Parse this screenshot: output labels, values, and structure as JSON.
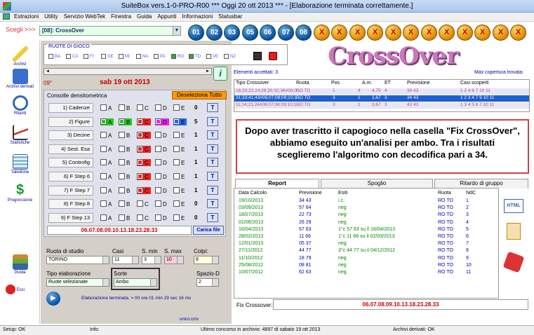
{
  "window": {
    "title": "SuiteBox vers.1-0-PRO-R00  ***  Oggi 20 ott 2013  ***  - [Elaborazione terminata correttamente.]"
  },
  "menu": [
    "Estrazioni",
    "Utility",
    "Servizio WebTek",
    "Finestra",
    "Guida",
    "Appunti",
    "Informazioni",
    "Statusbar"
  ],
  "toolbar": {
    "scegli_label": "Scegli >>>",
    "combo_value": "[08]: CrossOver",
    "numbers": [
      "01",
      "02",
      "03",
      "05",
      "06",
      "07",
      "08"
    ],
    "x_label": "X"
  },
  "sidebar": [
    {
      "label": "Archivi"
    },
    {
      "label": "Archivi derivati"
    },
    {
      "label": "Ritardi"
    },
    {
      "label": "Statistiche"
    },
    {
      "label": "Tabellone"
    },
    {
      "label": "Progressione"
    },
    {
      "label": "Guida"
    },
    {
      "label": "Esci"
    }
  ],
  "ruote": {
    "title": "RUOTE DI GIOCO",
    "items": [
      {
        "label": "BA",
        "on": false
      },
      {
        "label": "CA",
        "on": false
      },
      {
        "label": "FI",
        "on": false
      },
      {
        "label": "GE",
        "on": false
      },
      {
        "label": "MI",
        "on": false
      },
      {
        "label": "NA",
        "on": false
      },
      {
        "label": "PA",
        "on": false
      },
      {
        "label": "RO",
        "on": true
      },
      {
        "label": "TO",
        "on": true
      },
      {
        "label": "VE",
        "on": false
      },
      {
        "label": "NZ",
        "on": false
      }
    ]
  },
  "header": {
    "date_num": "09°",
    "date": "sab 19 ott 2013",
    "info_icon": "i"
  },
  "console": {
    "title": "Consolle densitometrica",
    "deselect": "Deseleziona Tutto",
    "rows": [
      {
        "label": "1) Cadenze",
        "count": "0",
        "checks": [
          0,
          0,
          0,
          0,
          0
        ]
      },
      {
        "label": "2) Figure",
        "count": "5",
        "checks": [
          1,
          1,
          1,
          1,
          1
        ]
      },
      {
        "label": "3) Decine",
        "count": "1",
        "checks": [
          0,
          0,
          1,
          0,
          0
        ]
      },
      {
        "label": "4) Sest. Esa",
        "count": "1",
        "checks": [
          0,
          0,
          1,
          0,
          0
        ]
      },
      {
        "label": "5) Controfig",
        "count": "1",
        "checks": [
          0,
          0,
          1,
          0,
          0
        ]
      },
      {
        "label": "6) F Step 6",
        "count": "1",
        "checks": [
          0,
          0,
          1,
          0,
          0
        ]
      },
      {
        "label": "7) F Step 7",
        "count": "1",
        "checks": [
          0,
          0,
          1,
          0,
          0
        ]
      },
      {
        "label": "8) F Step 8",
        "count": "0",
        "checks": [
          0,
          0,
          0,
          0,
          0
        ]
      },
      {
        "label": "9) F Step 13",
        "count": "0",
        "checks": [
          0,
          0,
          0,
          0,
          0
        ]
      }
    ],
    "letters": [
      "A",
      "B",
      "C",
      "D",
      "E"
    ],
    "t_label": "T",
    "numbers_line": "06.07.08.09.10.13.18.23.28.33",
    "carica": "Carica file"
  },
  "study": {
    "ruota_label": "Ruota di studio",
    "ruota_value": "TORINO",
    "casi_label": "Casi",
    "casi_value": "11",
    "smin_label": "S. min",
    "smin_value": "3",
    "smax_label": "S. max",
    "smax_value": "10",
    "colpi_label": "Colpi:",
    "colpi_value": "8",
    "tipo_label": "Tipo elaborazione",
    "tipo_value": "Ruote selezionate",
    "sorte_label": "Sorte",
    "sorte_value": "Ambo",
    "spazio_label": "Spazio-D",
    "spazio_value": "2",
    "status": "Elaborazione terminata. > 00 ore 01 min 29 sec 16 ms",
    "unico": "unico.cmx"
  },
  "results": {
    "accepted": "Elementi accettati: 3",
    "coverage": "Max copertura trovata:",
    "headers": [
      "Tipo Crossover",
      "Ruota",
      "Pos",
      "A.m.",
      "ET",
      "Previsione",
      "Casi scoperti"
    ],
    "rows": [
      [
        "16;20;22;24;28;30;32;36#06;0...",
        "RO TO",
        "1",
        "4",
        "4,75",
        "4",
        "39 43",
        "1 2 4 6 7 10 11"
      ],
      [
        "31;33;41;43#06;07;08;09;10;1...",
        "RO TO",
        "3",
        "1",
        "1,67",
        "3",
        "34 43",
        "1 2 3 4 7 9 10 11"
      ],
      [
        "11;14;21;24#06;07;08;09;10;1...",
        "RO TO",
        "3",
        "1",
        "3,67",
        "3",
        "42 43",
        "1 3 4 5 6 7 10 11"
      ]
    ]
  },
  "note": "Dopo aver trascritto il capogioco nella casella \"Fix CrossOver\", abbiamo eseguito un'analisi per ambo. Tra i risultati sceglieremo l'algoritmo con decodifica pari a 34.",
  "tabs": [
    "Report",
    "Spoglio",
    "Ritardo di gruppo"
  ],
  "report": {
    "headers": [
      "Data Calcolo",
      "Previsione",
      "Esiti",
      "Ruota",
      "NdC"
    ],
    "rows": [
      [
        "19/10/2013",
        "34 43",
        "i.c.",
        "RO TO",
        "1"
      ],
      [
        "03/09/2013",
        "57 64",
        "neg",
        "RO TO",
        "2"
      ],
      [
        "18/07/2013",
        "22 73",
        "neg",
        "RO TO",
        "3"
      ],
      [
        "01/06/2013",
        "26 29",
        "neg",
        "RO TO",
        "4"
      ],
      [
        "16/04/2013",
        "57 63",
        "1°c 57 63 su il 18/04/2013",
        "RO TO",
        "5"
      ],
      [
        "28/02/2013",
        "11 66",
        "1°c 11 66 su il 02/03/2013",
        "RO TO",
        "6"
      ],
      [
        "12/01/2013",
        "05 37",
        "neg",
        "RO TO",
        "7"
      ],
      [
        "27/11/2012",
        "44 77",
        "3°c 44 77 su il 04/12/2012",
        "RO TO",
        "8"
      ],
      [
        "11/10/2012",
        "18 79",
        "neg",
        "RO TO",
        "9"
      ],
      [
        "25/08/2012",
        "08 81",
        "neg",
        "RO TO",
        "10"
      ],
      [
        "10/07/2012",
        "62 63",
        "neg",
        "RO TO",
        "11"
      ]
    ]
  },
  "fix": {
    "label": "Fix Crossover:",
    "value": "06.07.08.09.10.13.18.23.28.33"
  },
  "statusbar": {
    "setup": "Setup: OK",
    "info": "Info:",
    "last": "Ultimo concorso in archivio: 4897 di sabato 19 ott 2013",
    "derived": "Archivi derivati: OK"
  },
  "logo": "CrossOver"
}
